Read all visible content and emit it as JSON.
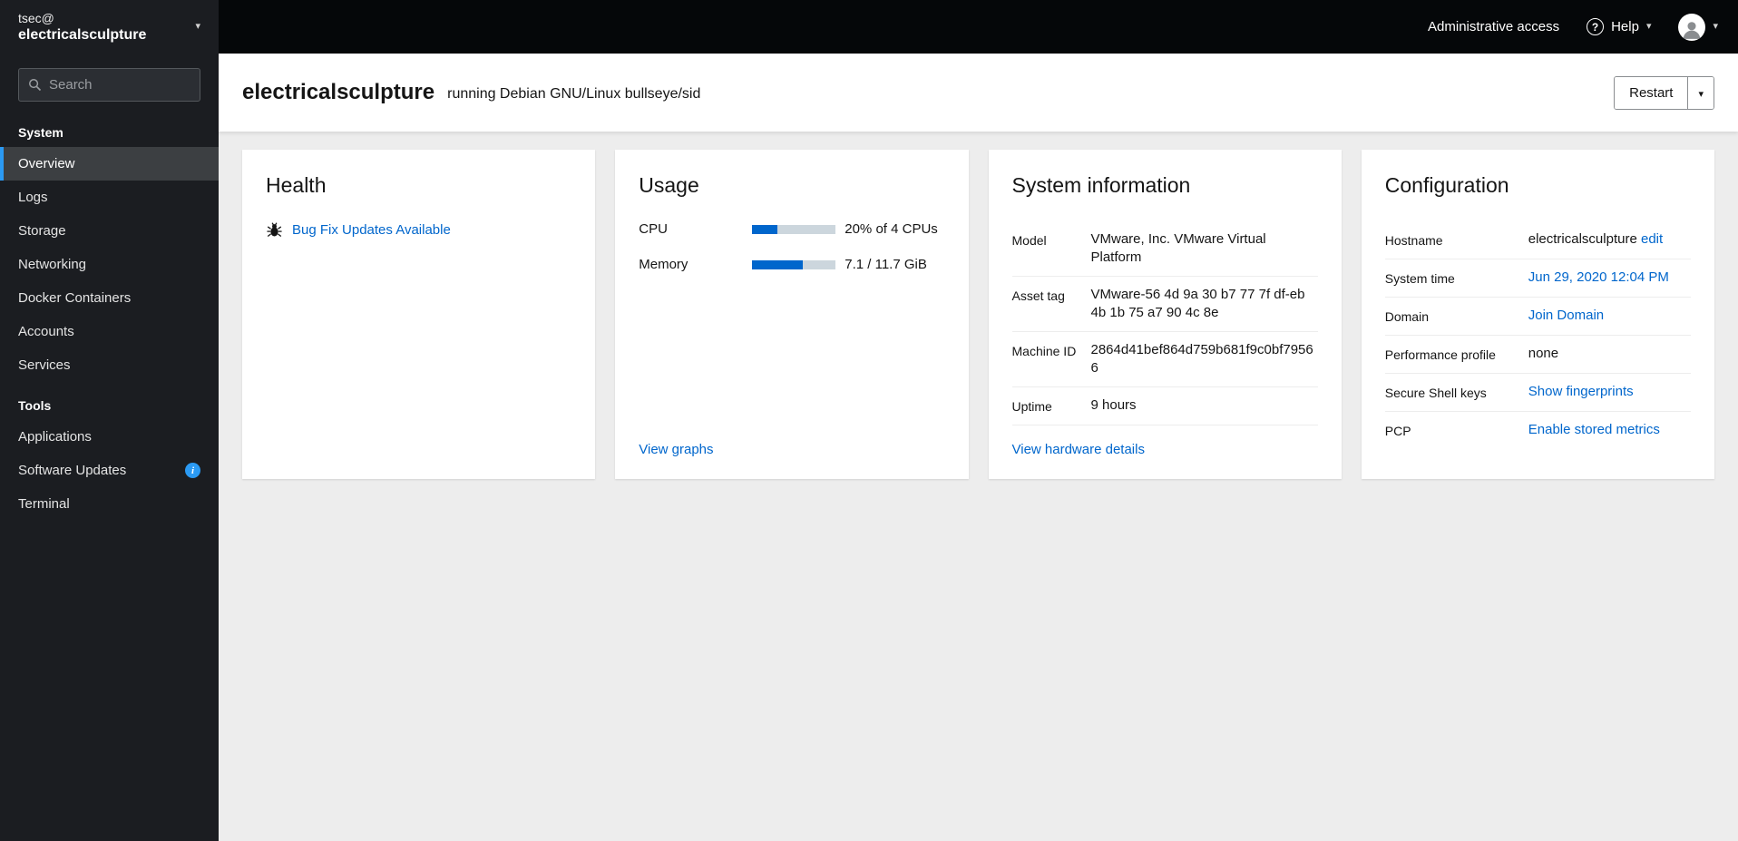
{
  "colors": {
    "accent_link": "#0066cc",
    "nav_active_indicator": "#2b9af3",
    "progress_fill": "#0066cc",
    "info_badge": "#2b9af3"
  },
  "sidebar": {
    "user": "tsec@",
    "host": "electricalsculpture",
    "search_placeholder": "Search",
    "system_section_label": "System",
    "tools_section_label": "Tools",
    "system_items": [
      "Overview",
      "Logs",
      "Storage",
      "Networking",
      "Docker Containers",
      "Accounts",
      "Services"
    ],
    "tools_items": [
      "Applications",
      "Software Updates",
      "Terminal"
    ]
  },
  "topbar": {
    "admin_access_label": "Administrative access",
    "help_label": "Help"
  },
  "page_header": {
    "hostname": "electricalsculpture",
    "os_text": "running Debian GNU/Linux bullseye/sid",
    "restart_label": "Restart"
  },
  "health": {
    "title": "Health",
    "updates_link": "Bug Fix Updates Available"
  },
  "usage": {
    "title": "Usage",
    "cpu_label": "CPU",
    "cpu_value": "20% of 4 CPUs",
    "cpu_percent": 30,
    "memory_label": "Memory",
    "memory_value": "7.1 / 11.7 GiB",
    "memory_percent": 61,
    "view_graphs_link": "View graphs"
  },
  "system_info": {
    "title": "System information",
    "rows": [
      {
        "label": "Model",
        "value": "VMware, Inc. VMware Virtual Platform"
      },
      {
        "label": "Asset tag",
        "value": "VMware-56 4d 9a 30 b7 77 7f df-eb 4b 1b 75 a7 90 4c 8e"
      },
      {
        "label": "Machine ID",
        "value": "2864d41bef864d759b681f9c0bf79566"
      },
      {
        "label": "Uptime",
        "value": "9 hours"
      }
    ],
    "details_link": "View hardware details"
  },
  "configuration": {
    "title": "Configuration",
    "hostname_label": "Hostname",
    "hostname_value": "electricalsculpture",
    "hostname_edit_link": "edit",
    "system_time_label": "System time",
    "system_time_link": "Jun 29, 2020 12:04 PM",
    "domain_label": "Domain",
    "domain_link": "Join Domain",
    "performance_label": "Performance profile",
    "performance_value": "none",
    "ssh_keys_label": "Secure Shell keys",
    "ssh_keys_link": "Show fingerprints",
    "pcp_label": "PCP",
    "pcp_link": "Enable stored metrics"
  }
}
